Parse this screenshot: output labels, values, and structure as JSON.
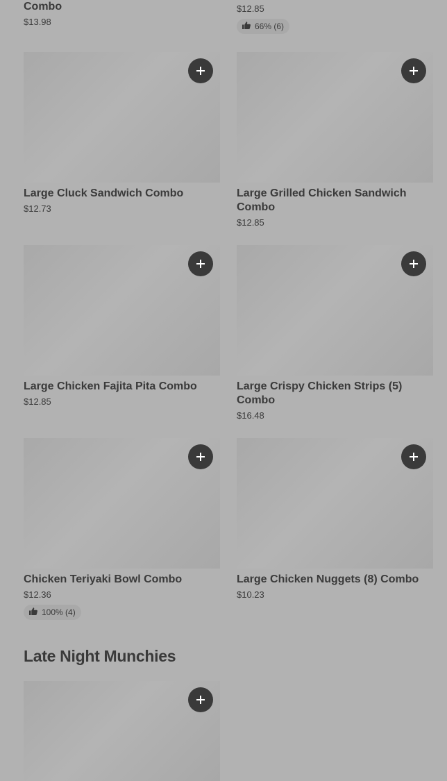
{
  "top_items": [
    {
      "name_tail": "Combo",
      "price": "$13.98"
    },
    {
      "price": "$12.85",
      "rating": "66% (6)"
    }
  ],
  "items": [
    {
      "name": "Large Cluck Sandwich Combo",
      "price": "$12.73"
    },
    {
      "name": "Large Grilled Chicken Sandwich Combo",
      "price": "$12.85"
    },
    {
      "name": "Large Chicken Fajita Pita Combo",
      "price": "$12.85"
    },
    {
      "name": "Large Crispy Chicken Strips (5) Combo",
      "price": "$16.48"
    },
    {
      "name": "Chicken Teriyaki Bowl Combo",
      "price": "$12.36",
      "rating": "100% (4)"
    },
    {
      "name": "Large Chicken Nuggets (8) Combo",
      "price": "$10.23"
    }
  ],
  "late_night": {
    "title": "Late Night Munchies"
  },
  "icons": {
    "add": "plus-icon",
    "rating": "thumbs-up-icon"
  },
  "colors": {
    "background": "#b2b2b2",
    "button": "#3a3a3a",
    "text": "#3a3a3a"
  }
}
